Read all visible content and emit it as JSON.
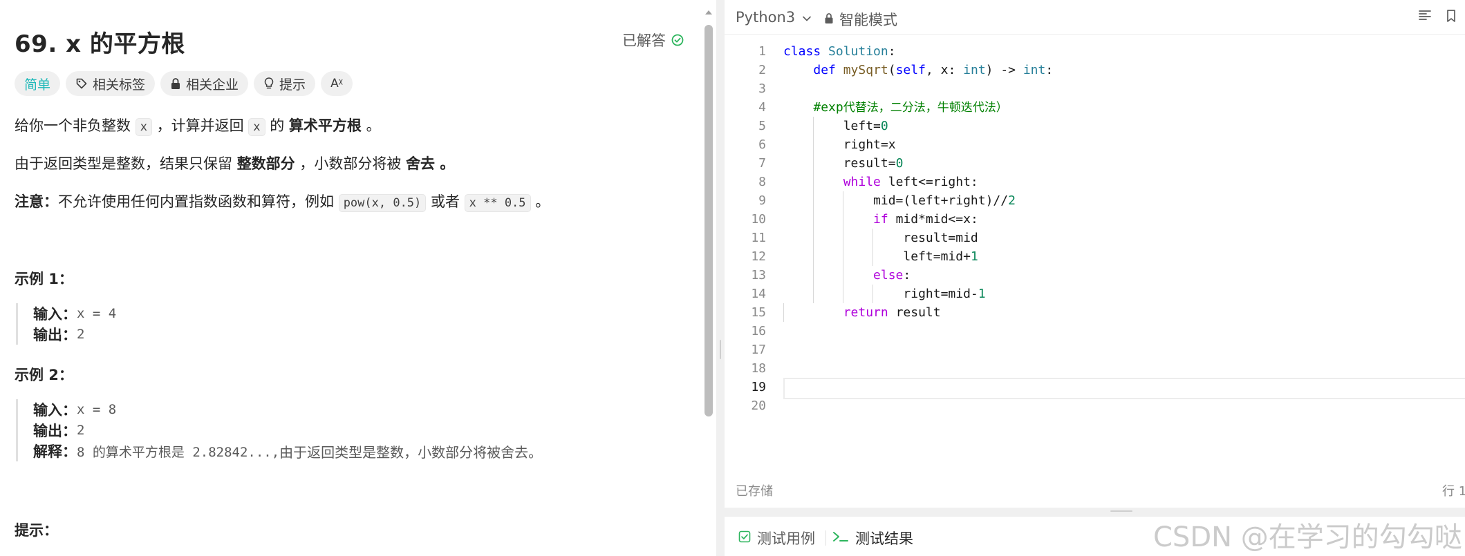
{
  "problem": {
    "title": "69. x 的平方根",
    "status": "已解答",
    "tags": [
      {
        "label": "简单"
      },
      {
        "label": "相关标签"
      },
      {
        "label": "相关企业"
      },
      {
        "label": "提示"
      },
      {
        "label": "Aᵡ"
      }
    ],
    "desc1": {
      "a": "给你一个非负整数 ",
      "code1": "x",
      "b": " ，计算并返回 ",
      "code2": "x",
      "c": " 的 ",
      "bold": "算术平方根",
      "d": " 。"
    },
    "desc2": {
      "a": "由于返回类型是整数，结果只保留 ",
      "bold1": "整数部分",
      "b": " ，小数部分将被 ",
      "bold2": "舍去 。"
    },
    "desc3": {
      "bold": "注意：",
      "a": "不允许使用任何内置指数函数和算符，例如 ",
      "code1": "pow(x, 0.5)",
      "b": " 或者 ",
      "code2": "x ** 0.5",
      "c": " 。"
    },
    "example1": {
      "head": "示例 1：",
      "input_label": "输入：",
      "input_value": "x = 4",
      "output_label": "输出：",
      "output_value": "2"
    },
    "example2": {
      "head": "示例 2：",
      "input_label": "输入：",
      "input_value": "x = 8",
      "output_label": "输出：",
      "output_value": "2",
      "explain_label": "解释：",
      "explain_a": "8 的算术平方根是 2.82842...,",
      "explain_b": " 由于返回类型是整数，小数部分将被舍去。"
    },
    "hints_head": "提示："
  },
  "editor": {
    "language": "Python3",
    "mode": "智能模式",
    "line_numbers": [
      "1",
      "2",
      "3",
      "4",
      "5",
      "6",
      "7",
      "8",
      "9",
      "10",
      "11",
      "12",
      "13",
      "14",
      "15",
      "16",
      "17",
      "18",
      "19",
      "20"
    ],
    "active_line": "19",
    "status_saved": "已存储",
    "status_pos": "行 1"
  },
  "bottom": {
    "tab_cases": "测试用例",
    "tab_result": "测试结果"
  },
  "watermark": "CSDN @在学习的勾勾哒",
  "colors": {
    "easy": "#1cb8b8",
    "solved": "#2db55d",
    "result_icon": "#2db55d"
  }
}
